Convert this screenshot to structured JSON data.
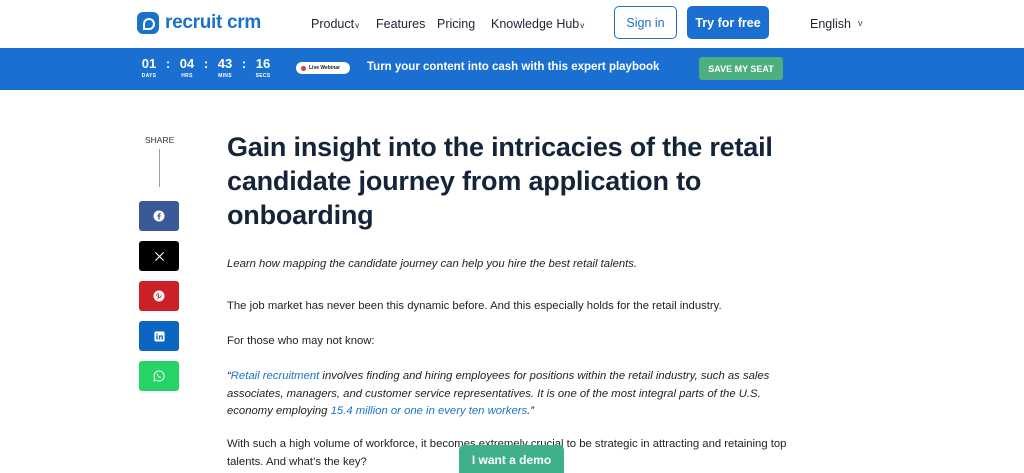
{
  "header": {
    "logo_text": "recruit crm",
    "nav": [
      {
        "label": "Product",
        "caret": "v"
      },
      {
        "label": "Features"
      },
      {
        "label": "Pricing"
      },
      {
        "label": "Knowledge Hub",
        "caret": "v"
      }
    ],
    "signin_label": "Sign in",
    "try_label": "Try for free",
    "language": "English",
    "language_caret": "v"
  },
  "banner": {
    "timer": [
      {
        "value": "01",
        "label": "DAYS"
      },
      {
        "value": "04",
        "label": "HRS"
      },
      {
        "value": "43",
        "label": "MINS"
      },
      {
        "value": "16",
        "label": "SECS"
      }
    ],
    "separator": ":",
    "live_label": "Live Webinar",
    "message": "Turn your content into cash with this expert playbook",
    "cta_label": "SAVE MY SEAT"
  },
  "share": {
    "label": "SHARE",
    "buttons": [
      {
        "name": "facebook",
        "icon": "facebook-icon",
        "color": "#3b5998"
      },
      {
        "name": "x",
        "icon": "x-icon",
        "color": "#000000"
      },
      {
        "name": "pinterest",
        "icon": "pinterest-icon",
        "color": "#cb2027"
      },
      {
        "name": "linkedin",
        "icon": "linkedin-icon",
        "color": "#0a66c2"
      },
      {
        "name": "whatsapp",
        "icon": "whatsapp-icon",
        "color": "#25d366"
      }
    ]
  },
  "article": {
    "title": "Gain insight into the intricacies of the retail candidate journey from application to onboarding",
    "subtitle": "Learn how mapping the candidate journey can help you hire the best retail talents.",
    "p1": "The job market has never been this dynamic before. And this especially holds for the retail industry.",
    "p2": "For those who may not know:",
    "quote_open": "“",
    "quote_link1": "Retail recruitment",
    "quote_mid": " involves finding and hiring employees for positions within the retail industry, such as sales associates, managers, and customer service representatives. It is one of the most integral parts of the U.S. economy employing ",
    "quote_link2": "15.4 million or one in every ten workers",
    "quote_close": ".”",
    "p4": "With such a high volume of workforce, it becomes extremely crucial to be strategic in attracting and retaining top talents. And what’s the key?"
  },
  "demo_button": "I want a demo",
  "colors": {
    "brand_blue": "#1a73c8",
    "banner_blue": "#1b6fd1",
    "cta_green": "#4caf7d",
    "demo_green": "#3fb08a",
    "title_navy": "#16243a"
  }
}
